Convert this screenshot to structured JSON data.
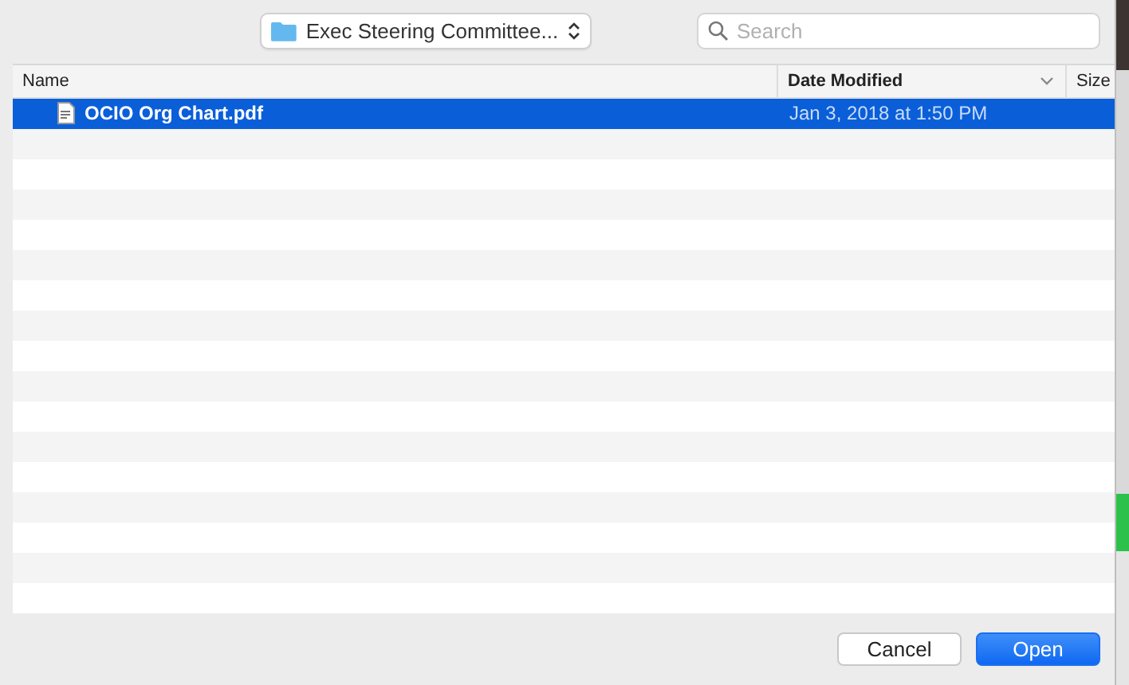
{
  "location_popup": {
    "label": "Exec Steering Committee..."
  },
  "search": {
    "placeholder": "Search"
  },
  "columns": [
    {
      "label": "Name",
      "sorted": false
    },
    {
      "label": "Date Modified",
      "sorted": true
    },
    {
      "label": "Size",
      "sorted": false
    }
  ],
  "rows": [
    {
      "name": "OCIO Org Chart.pdf",
      "date_modified": "Jan 3, 2018 at 1:50 PM",
      "selected": true
    }
  ],
  "buttons": [
    {
      "label": "Cancel",
      "kind": "default"
    },
    {
      "label": "Open",
      "kind": "primary"
    }
  ]
}
